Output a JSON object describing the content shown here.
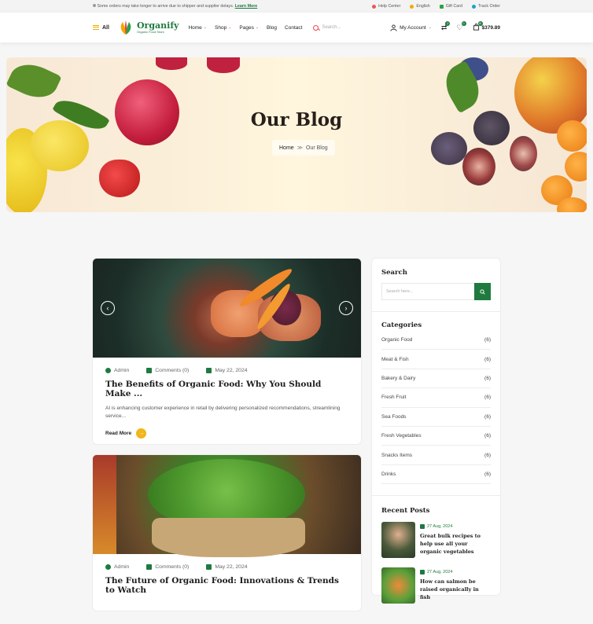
{
  "topbar": {
    "notice": "Some orders may take longer to arrive due to shipper and supplier delays.",
    "notice_link": "Learn More",
    "links": [
      {
        "label": "Help Center",
        "icon": "help-icon",
        "color": "#e55"
      },
      {
        "label": "English",
        "icon": "flag-icon",
        "color": "#f2a900"
      },
      {
        "label": "Gift Card",
        "icon": "gift-icon",
        "color": "#2aa34a"
      },
      {
        "label": "Track Order",
        "icon": "track-icon",
        "color": "#1aa3c7"
      }
    ]
  },
  "header": {
    "all_label": "All",
    "logo_name": "Organify",
    "logo_tagline": "Organic Food Store",
    "nav": [
      "Home",
      "Shop",
      "Pages",
      "Blog",
      "Contact"
    ],
    "search_placeholder": "Search...",
    "account_label": "My Account",
    "compare_count": "2",
    "wishlist_count": "0",
    "cart_count": "0",
    "cart_total": "$379.89"
  },
  "hero": {
    "title": "Our Blog",
    "breadcrumb_home": "Home",
    "breadcrumb_sep": "≫",
    "breadcrumb_current": "Our Blog"
  },
  "posts": [
    {
      "author": "Admin",
      "comments": "Comments (0)",
      "date": "May 22, 2024",
      "title": "The Benefits of Organic Food: Why You Should Make ...",
      "excerpt": "AI is enhancing customer experience in retail by delivering personalized recommendations, streamlining service...",
      "read_more": "Read More"
    },
    {
      "author": "Admin",
      "comments": "Comments (0)",
      "date": "May 22, 2024",
      "title": "The Future of Organic Food: Innovations & Trends to Watch"
    }
  ],
  "sidebar": {
    "search_title": "Search",
    "search_placeholder": "Search here...",
    "categories_title": "Categories",
    "categories": [
      {
        "name": "Organic Food",
        "count": "(6)"
      },
      {
        "name": "Meat & Fish",
        "count": "(6)"
      },
      {
        "name": "Bakery & Dairy",
        "count": "(6)"
      },
      {
        "name": "Fresh Fruit",
        "count": "(6)"
      },
      {
        "name": "Sea Foods",
        "count": "(6)"
      },
      {
        "name": "Fresh Vegetables",
        "count": "(6)"
      },
      {
        "name": "Snacks Items",
        "count": "(6)"
      },
      {
        "name": "Drinks",
        "count": "(6)"
      }
    ],
    "recent_title": "Recent Posts",
    "recent": [
      {
        "date": "27 Aug, 2024",
        "title": "Great bulk recipes to help use all your organic vegetables"
      },
      {
        "date": "27 Aug, 2024",
        "title": "How can salmon be raised organically in fish"
      }
    ]
  },
  "colors": {
    "brand": "#1f7a3f",
    "accent": "#f2b51a",
    "red": "#e44"
  }
}
